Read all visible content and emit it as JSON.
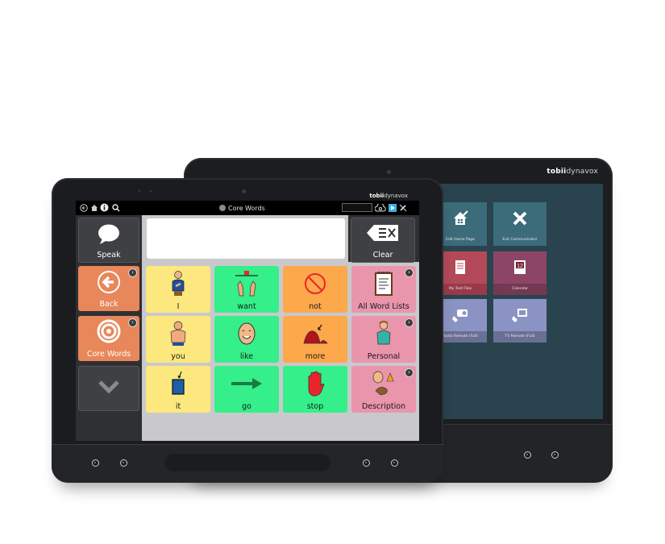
{
  "back_device": {
    "brand": {
      "bold": "tobii",
      "light": "dynavox"
    },
    "tiles": [
      {
        "label": "Edit Home Page",
        "icon": "house-edit-icon",
        "color": "#3c6b7a"
      },
      {
        "label": "Exit Communicator",
        "icon": "x-close-icon",
        "color": "#3c6b7a"
      },
      {
        "label": "My Text Files",
        "icon": "notebook-icon",
        "color": "#b4495a"
      },
      {
        "label": "Calendar",
        "icon": "calendar-icon",
        "color": "#8d4566",
        "calendar_day": "12"
      },
      {
        "label": "Radio Remote (Full)",
        "icon": "radio-remote-icon",
        "color": "#8b93c4"
      },
      {
        "label": "TV Remote (Full)",
        "icon": "tv-remote-icon",
        "color": "#8b93c4"
      }
    ]
  },
  "front_device": {
    "brand": {
      "bold": "tobii",
      "light": "dynavox"
    },
    "topbar": {
      "left_icons": [
        "back-icon",
        "home-icon",
        "info-icon",
        "search-icon"
      ],
      "page_title": "Core Words",
      "right_icons": [
        "cloud-sync-icon",
        "play-icon",
        "edit-off-icon"
      ]
    },
    "speak_button": {
      "label": "Speak"
    },
    "clear_button": {
      "label": "Clear"
    },
    "message_text": "",
    "side_buttons": [
      {
        "label": "Back",
        "icon": "back-arrow-icon"
      },
      {
        "label": "Core Words",
        "icon": "target-icon"
      },
      {
        "label": "",
        "icon": "chevron-down-icon"
      }
    ],
    "word_tiles": [
      {
        "label": "I",
        "color": "yellow",
        "icon": "person-self-icon",
        "linked": false
      },
      {
        "label": "want",
        "color": "green",
        "icon": "want-hands-icon",
        "linked": false
      },
      {
        "label": "not",
        "color": "orange",
        "icon": "no-symbol-icon",
        "linked": false
      },
      {
        "label": "All Word Lists",
        "color": "pink",
        "icon": "notepad-icon",
        "linked": true
      },
      {
        "label": "you",
        "color": "yellow",
        "icon": "pointing-hand-icon",
        "linked": false
      },
      {
        "label": "like",
        "color": "green",
        "icon": "smiley-face-icon",
        "linked": false
      },
      {
        "label": "more",
        "color": "orange",
        "icon": "pile-icon",
        "linked": false
      },
      {
        "label": "Personal",
        "color": "pink",
        "icon": "person-icon",
        "linked": true
      },
      {
        "label": "it",
        "color": "yellow",
        "icon": "blue-box-icon",
        "linked": false
      },
      {
        "label": "go",
        "color": "green",
        "icon": "right-arrow-icon",
        "linked": false
      },
      {
        "label": "stop",
        "color": "green",
        "icon": "stop-hand-icon",
        "linked": false
      },
      {
        "label": "Description",
        "color": "pink",
        "icon": "description-icon",
        "linked": true
      }
    ]
  }
}
